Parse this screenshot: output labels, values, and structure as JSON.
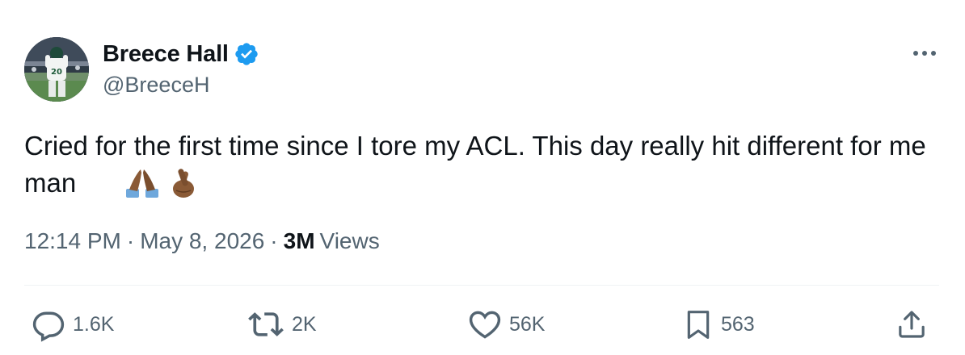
{
  "author": {
    "name": "Breece Hall",
    "handle": "@BreeceH",
    "avatar_icon": "avatar-football-player",
    "verified_color": "#1d9bf0"
  },
  "tweet": {
    "text": "Cried for the first time since I tore my ACL. This day really hit different for me man",
    "emojis": [
      "folded-hands-emoji",
      "crossed-fingers-emoji"
    ],
    "time": "12:14 PM",
    "date": "May 8, 2026",
    "separator": "·",
    "views_count": "3M",
    "views_label": "Views"
  },
  "actions": {
    "replies": "1.6K",
    "reposts": "2K",
    "likes": "56K",
    "bookmarks": "563"
  },
  "colors": {
    "text": "#0f1419",
    "secondary": "#536471",
    "divider": "#eff3f4",
    "accent": "#1d9bf0"
  }
}
